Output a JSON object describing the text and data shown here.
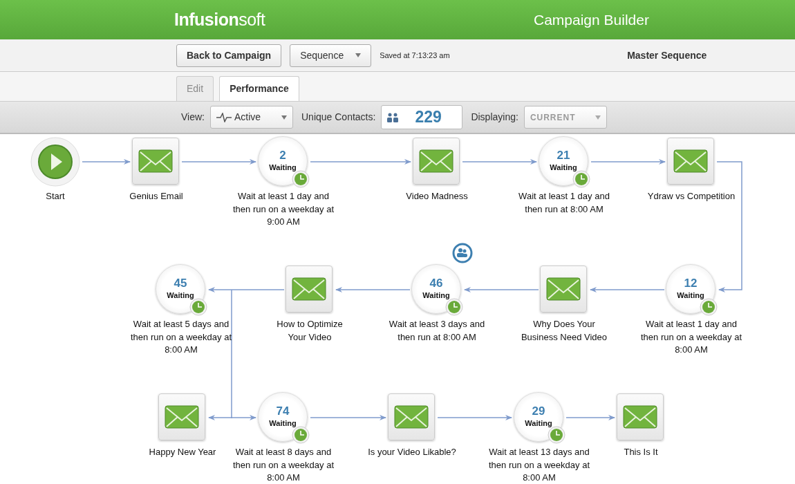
{
  "header": {
    "logo": "**Infusion**soft",
    "title": "Campaign Builder"
  },
  "toolbar": {
    "back_button": "Back to Campaign",
    "sequence_menu": "Sequence",
    "saved_status": "Saved at 7:13:23 am",
    "sequence_name": "Master Sequence"
  },
  "tabs": [
    {
      "label": "Edit",
      "selected": false
    },
    {
      "label": "Performance",
      "selected": true
    }
  ],
  "filters": {
    "view_label": "View:",
    "view_value": "Active",
    "contacts_label": "Unique Contacts:",
    "contacts_count": "229",
    "displaying_label": "Displaying:",
    "displaying_value": "CURRENT",
    "displaying_disabled": true
  },
  "flow_rows": [
    {
      "nodes": [
        {
          "kind": "start",
          "label": "Start"
        },
        {
          "kind": "email",
          "label": "Genius Email"
        },
        {
          "kind": "timer",
          "count": "2",
          "status": "Waiting",
          "label": "Wait at least 1 day and then run on a weekday at 9:00 AM"
        },
        {
          "kind": "email",
          "label": "Video Madness"
        },
        {
          "kind": "timer",
          "count": "21",
          "status": "Waiting",
          "label": "Wait at least 1 day and then run at 8:00 AM"
        },
        {
          "kind": "email",
          "label": "Ydraw vs Competition"
        }
      ]
    },
    {
      "nodes": [
        {
          "kind": "timer",
          "count": "45",
          "status": "Waiting",
          "label": "Wait at least 5 days and then run on a weekday at 8:00 AM"
        },
        {
          "kind": "email",
          "label": "How to Optimize Your Video"
        },
        {
          "kind": "timer",
          "count": "46",
          "status": "Waiting",
          "label": "Wait at least 3 days and then run at 8:00 AM",
          "contacts_badge": true
        },
        {
          "kind": "email",
          "label": "Why Does Your Business Need Video"
        },
        {
          "kind": "timer",
          "count": "12",
          "status": "Waiting",
          "label": "Wait at least 1 day and then run on a weekday at 8:00 AM"
        }
      ]
    },
    {
      "nodes": [
        {
          "kind": "email",
          "label": "Happy New Year"
        },
        {
          "kind": "timer",
          "count": "74",
          "status": "Waiting",
          "label": "Wait at least 8 days and then run on a weekday at 8:00 AM"
        },
        {
          "kind": "email",
          "label": "Is your Video Likable?"
        },
        {
          "kind": "timer",
          "count": "29",
          "status": "Waiting",
          "label": "Wait at least 13 days and then run on a weekday at 8:00 AM"
        },
        {
          "kind": "email",
          "label": "This Is It"
        }
      ]
    }
  ]
}
